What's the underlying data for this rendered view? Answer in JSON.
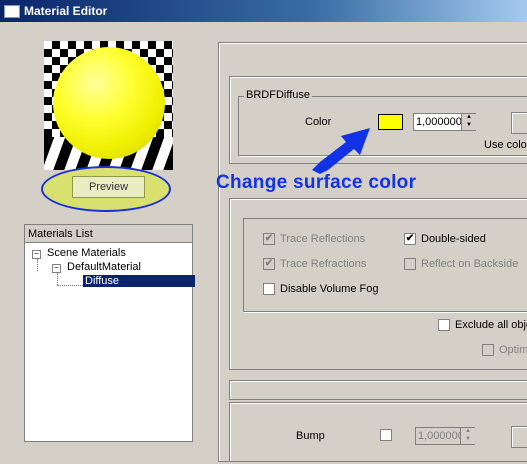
{
  "window": {
    "title": "Material Editor"
  },
  "preview": {
    "button_label": "Preview"
  },
  "materials_list": {
    "header": "Materials List",
    "items": [
      {
        "label": "Scene Materials",
        "expander": "−"
      },
      {
        "label": "DefaultMaterial",
        "expander": "−"
      },
      {
        "label": "Diffuse"
      }
    ]
  },
  "brdf": {
    "group_label": "BRDFDiffuse",
    "color_label": "Color",
    "color_value": "#ffff00",
    "color_amount": "1,000000",
    "use_color_label": "Use color"
  },
  "annotation": {
    "text": "Change surface color",
    "color": "#1232e8"
  },
  "options": {
    "trace_reflections": {
      "label": "Trace Reflections",
      "checked": true,
      "enabled": false
    },
    "trace_refractions": {
      "label": "Trace Refractions",
      "checked": true,
      "enabled": false
    },
    "disable_volume_fog": {
      "label": "Disable Volume Fog",
      "checked": false,
      "enabled": true
    },
    "double_sided": {
      "label": "Double-sided",
      "checked": true,
      "enabled": true
    },
    "reflect_on_backside": {
      "label": "Reflect on Backside",
      "checked": false,
      "enabled": false
    },
    "exclude_all_objects": {
      "label": "Exclude all obje",
      "checked": false,
      "enabled": true
    },
    "optimize": {
      "label": "Optim",
      "checked": false,
      "enabled": false
    }
  },
  "bump": {
    "label": "Bump",
    "checked": false,
    "amount": "1,000000"
  }
}
